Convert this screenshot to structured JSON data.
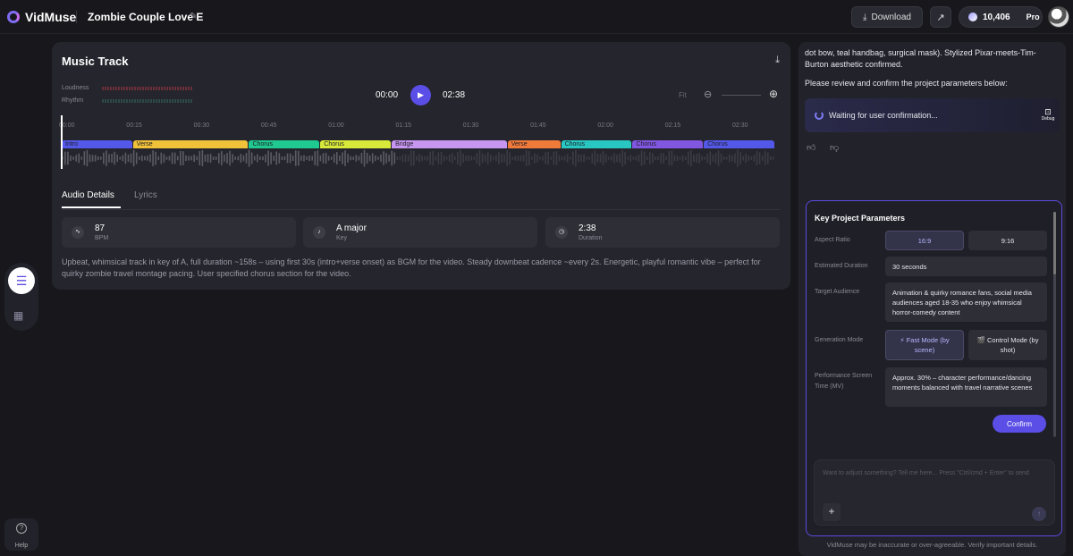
{
  "header": {
    "app_name": "VidMuse",
    "project_title": "Zombie Couple Love E",
    "edit_icon": "magic-edit-icon",
    "download_label": "Download",
    "credits": "10,406",
    "plan": "Pro"
  },
  "sidebar": {
    "doc_icon": "clipboard-icon",
    "film_icon": "film-strip-icon",
    "help_label": "Help"
  },
  "music": {
    "title": "Music Track",
    "loudness_label": "Loudness",
    "rhythm_label": "Rhythm",
    "current_time": "00:00",
    "total_time": "02:38",
    "fit_label": "Fit",
    "ticks": [
      "00:00",
      "00:15",
      "00:30",
      "00:45",
      "01:00",
      "01:15",
      "01:30",
      "01:45",
      "02:00",
      "02:15",
      "02:30"
    ],
    "sections": [
      {
        "label": "Intro",
        "start": 0,
        "end": 16,
        "color": "#5458e8"
      },
      {
        "label": "Verse",
        "start": 16,
        "end": 42,
        "color": "#f0c23a"
      },
      {
        "label": "Chorus",
        "start": 42,
        "end": 58,
        "color": "#1fc98f"
      },
      {
        "label": "Chorus",
        "start": 58,
        "end": 74,
        "color": "#d7ea3a"
      },
      {
        "label": "Bridge",
        "start": 74,
        "end": 100,
        "color": "#c796f0"
      },
      {
        "label": "Verse",
        "start": 100,
        "end": 112,
        "color": "#f07a3a"
      },
      {
        "label": "Chorus",
        "start": 112,
        "end": 128,
        "color": "#29c7c1"
      },
      {
        "label": "Chorus",
        "start": 128,
        "end": 144,
        "color": "#8156e0"
      },
      {
        "label": "Chorus",
        "start": 144,
        "end": 160,
        "color": "#5458e8"
      }
    ],
    "timeline_max": 160,
    "tabs": [
      "Audio Details",
      "Lyrics"
    ],
    "cards": [
      {
        "icon": "waveform-icon",
        "value": "87",
        "label": "BPM"
      },
      {
        "icon": "music-note-icon",
        "value": "A major",
        "label": "Key"
      },
      {
        "icon": "clock-icon",
        "value": "2:38",
        "label": "Duration"
      }
    ],
    "description": "Upbeat, whimsical track in key of A, full duration ~158s – using first 30s (intro+verse onset) as BGM for the video. Steady downbeat cadence ~every 2s. Energetic, playful romantic vibe – perfect for quirky zombie travel montage pacing. User specified chorus section for the video."
  },
  "chat": {
    "message": "dot bow, teal handbag, surgical mask). Stylized Pixar-meets-Tim-Burton aesthetic confirmed.",
    "review": "Please review and confirm the project parameters below:",
    "waiting": "Waiting for user confirmation...",
    "debug_label": "Debug"
  },
  "params": {
    "title": "Key Project Parameters",
    "aspect_label": "Aspect Ratio",
    "aspect_options": [
      "16:9",
      "9:16"
    ],
    "duration_label": "Estimated Duration",
    "duration_value": "30 seconds",
    "audience_label": "Target Audience",
    "audience_value": "Animation & quirky romance fans, social media audiences aged 18-35 who enjoy whimsical horror-comedy content",
    "mode_label": "Generation Mode",
    "mode_fast": "⚡ Fast Mode (by scene)",
    "mode_control": "🎬 Control Mode (by shot)",
    "perf_label": "Performance Screen Time (MV)",
    "perf_value": "Approx. 30% – character performance/dancing moments balanced with travel narrative scenes",
    "confirm_label": "Confirm"
  },
  "input": {
    "placeholder": "Want to adjust something? Tell me here... Press \"Ctrl/cmd + Enter\" to send"
  },
  "disclaimer": "VidMuse may be inaccurate or over-agreeable. Verify important details."
}
